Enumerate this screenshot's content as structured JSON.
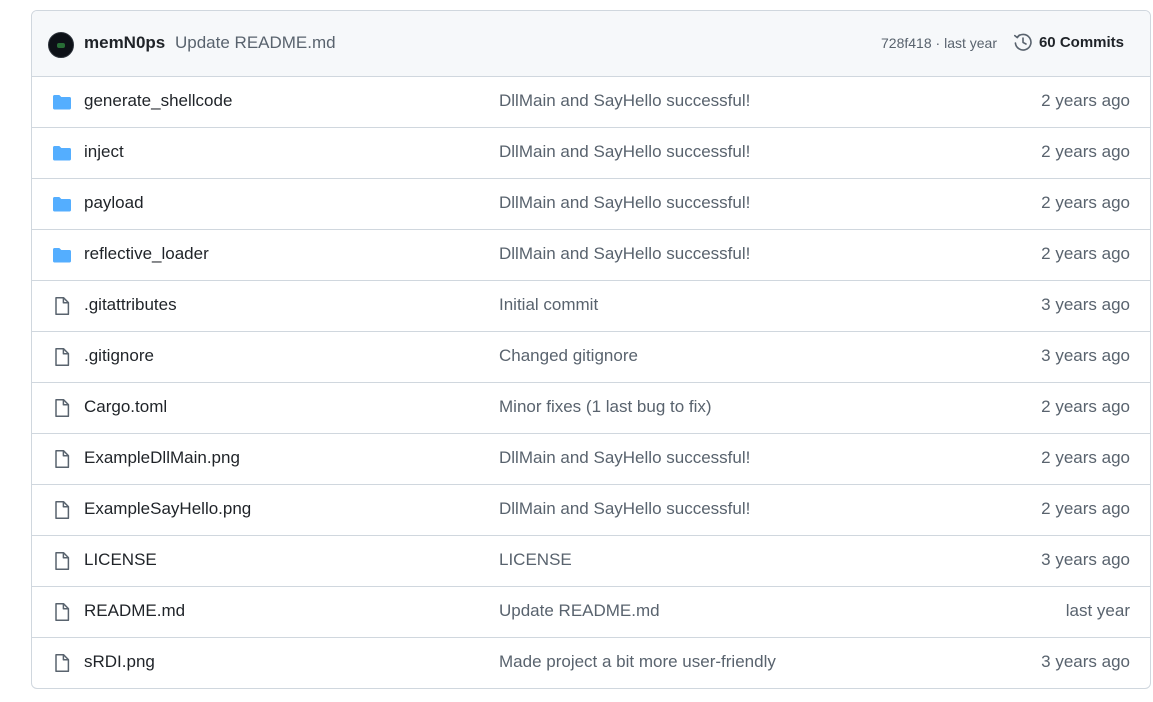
{
  "latest_commit": {
    "author": "memN0ps",
    "message": "Update README.md",
    "sha": "728f418",
    "separator": " · ",
    "time": "last year",
    "commits_label": "60 Commits"
  },
  "colors": {
    "folder": "#54aeff",
    "file": "#59636e",
    "border": "#d0d7de",
    "header_bg": "#f6f8fa"
  },
  "entries": [
    {
      "type": "folder",
      "icon": "folder-icon",
      "name": "generate_shellcode",
      "message": "DllMain and SayHello successful!",
      "age": "2 years ago"
    },
    {
      "type": "folder",
      "icon": "folder-icon",
      "name": "inject",
      "message": "DllMain and SayHello successful!",
      "age": "2 years ago"
    },
    {
      "type": "folder",
      "icon": "folder-icon",
      "name": "payload",
      "message": "DllMain and SayHello successful!",
      "age": "2 years ago"
    },
    {
      "type": "folder",
      "icon": "folder-icon",
      "name": "reflective_loader",
      "message": "DllMain and SayHello successful!",
      "age": "2 years ago"
    },
    {
      "type": "file",
      "icon": "file-icon",
      "name": ".gitattributes",
      "message": "Initial commit",
      "age": "3 years ago"
    },
    {
      "type": "file",
      "icon": "file-icon",
      "name": ".gitignore",
      "message": "Changed gitignore",
      "age": "3 years ago"
    },
    {
      "type": "file",
      "icon": "file-icon",
      "name": "Cargo.toml",
      "message": "Minor fixes (1 last bug to fix)",
      "age": "2 years ago"
    },
    {
      "type": "file",
      "icon": "file-icon",
      "name": "ExampleDllMain.png",
      "message": "DllMain and SayHello successful!",
      "age": "2 years ago"
    },
    {
      "type": "file",
      "icon": "file-icon",
      "name": "ExampleSayHello.png",
      "message": "DllMain and SayHello successful!",
      "age": "2 years ago"
    },
    {
      "type": "file",
      "icon": "file-icon",
      "name": "LICENSE",
      "message": "LICENSE",
      "age": "3 years ago"
    },
    {
      "type": "file",
      "icon": "file-icon",
      "name": "README.md",
      "message": "Update README.md",
      "age": "last year"
    },
    {
      "type": "file",
      "icon": "file-icon",
      "name": "sRDI.png",
      "message": "Made project a bit more user-friendly",
      "age": "3 years ago"
    }
  ]
}
